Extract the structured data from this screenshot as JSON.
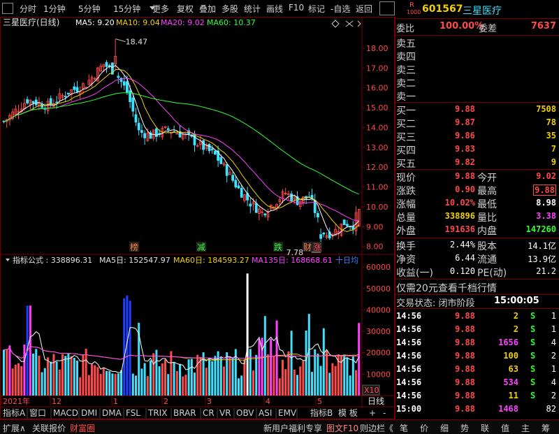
{
  "toolbar": {
    "left": [
      "分时",
      "1分钟",
      "5分钟",
      "15分钟",
      "更多"
    ],
    "right": [
      "复权",
      "叠加",
      "多股",
      "统计",
      "画线",
      "F10",
      "标记",
      "-自选",
      "返回"
    ]
  },
  "chart_header": {
    "name": "三星医疗(日线)",
    "ma": [
      {
        "label": "MA5: 9.20",
        "color": "#ffffff"
      },
      {
        "label": "MA10: 9.04",
        "color": "#f0d000"
      },
      {
        "label": "MA20: 9.02",
        "color": "#ff40ff"
      },
      {
        "label": "MA60: 10.37",
        "color": "#30ff30"
      }
    ],
    "high_marker": "18.47",
    "low_marker": "7.78"
  },
  "price_axis": [
    "18.00",
    "17.00",
    "16.00",
    "15.00",
    "14.00",
    "13.00",
    "12.00",
    "11.00",
    "10.00",
    "9.00",
    "8.00"
  ],
  "event_tags": [
    "榜",
    "减",
    "跌",
    "财",
    "涨"
  ],
  "vol_header": {
    "title": "指标公式 : 338896.31",
    "ma5": "MA5日: 152547.97",
    "ma60": "MA60日: 184593.27",
    "ma135": "MA135日: 168668.61",
    "tail": "十日均"
  },
  "vol_axis": [
    "60000",
    "50000",
    "40000",
    "30000",
    "20000",
    "10000"
  ],
  "vol_unit": "X10",
  "date_axis": [
    "2021年",
    "12",
    "1",
    "2",
    "3",
    "4",
    "5"
  ],
  "period_label": "日线",
  "indicator_tabs": [
    "指标A",
    "窗口",
    "MACD",
    "DMI",
    "DMA",
    "FSL",
    "TRIX",
    "BRAR",
    "CR",
    "VR",
    "OBV",
    "ASI",
    "EMV"
  ],
  "indicator_tabs_right": [
    "指标B",
    "模 板"
  ],
  "bottom_left": [
    "扩展∧",
    "关联报价",
    "财富圈"
  ],
  "bottom_mid": [
    "新用户福利专享",
    "图文F10",
    "则边栏《"
  ],
  "bottom_right": [
    "笔",
    "价",
    "细",
    "势",
    "联",
    "值",
    "主",
    "筹"
  ],
  "quote": {
    "badge_top": "R",
    "badge_bottom": "1000",
    "code": "601567",
    "name": "三星医疗",
    "weibi_label": "委比",
    "weibi": "100.00%",
    "weicha_label": "委差",
    "weicha": "7637",
    "sells": [
      "卖五",
      "卖四",
      "卖三",
      "卖二",
      "卖一"
    ],
    "buys": [
      {
        "label": "买一",
        "price": "9.88",
        "vol": "7508"
      },
      {
        "label": "买二",
        "price": "9.87",
        "vol": "78"
      },
      {
        "label": "买三",
        "price": "9.86",
        "vol": "35"
      },
      {
        "label": "买四",
        "price": "9.83",
        "vol": "7"
      },
      {
        "label": "买五",
        "price": "9.82",
        "vol": "9"
      }
    ],
    "stats": [
      {
        "l1": "现价",
        "v1": "9.88",
        "c1": "red",
        "l2": "今开",
        "v2": "9.02",
        "c2": "red"
      },
      {
        "l1": "涨跌",
        "v1": "0.90",
        "c1": "red",
        "l2": "最高",
        "v2": "9.88",
        "c2": "red"
      },
      {
        "l1": "涨幅",
        "v1": "10.02%",
        "c1": "red",
        "l2": "最低",
        "v2": "8.98",
        "c2": "white"
      },
      {
        "l1": "总量",
        "v1": "338896",
        "c1": "yellow",
        "l2": "量比",
        "v2": "3.38",
        "c2": "magenta"
      },
      {
        "l1": "外盘",
        "v1": "191636",
        "c1": "red",
        "l2": "内盘",
        "v2": "147260",
        "c2": "green"
      }
    ],
    "stats2": [
      {
        "l1": "换手",
        "v1": "2.44%",
        "l2": "股本",
        "v2": "14.1亿"
      },
      {
        "l1": "净资",
        "v1": "6.44",
        "l2": "流通",
        "v2": "13.9亿"
      },
      {
        "l1": "收益(一)",
        "v1": "0.120",
        "l2": "PE(动)",
        "v2": "21.2"
      }
    ],
    "promo": "仅需20元查看千档行情",
    "status_label": "交易状态: 闭市阶段",
    "status_time": "15:00:05",
    "ticks": [
      {
        "t": "14:56",
        "p": "9.88",
        "v": "2",
        "vc": "yellow",
        "s": "S",
        "n": "1"
      },
      {
        "t": "14:56",
        "p": "9.88",
        "v": "2",
        "vc": "yellow",
        "s": "S",
        "n": "1"
      },
      {
        "t": "14:56",
        "p": "9.88",
        "v": "1656",
        "vc": "magenta",
        "s": "S",
        "n": "4"
      },
      {
        "t": "14:56",
        "p": "9.88",
        "v": "100",
        "vc": "yellow",
        "s": "S",
        "n": "2"
      },
      {
        "t": "14:56",
        "p": "9.88",
        "v": "63",
        "vc": "yellow",
        "s": "S",
        "n": "1"
      },
      {
        "t": "14:56",
        "p": "9.88",
        "v": "534",
        "vc": "magenta",
        "s": "S",
        "n": "4"
      },
      {
        "t": "14:56",
        "p": "9.88",
        "v": "11",
        "vc": "yellow",
        "s": "S",
        "n": "2"
      },
      {
        "t": "15:00",
        "p": "9.88",
        "v": "1468",
        "vc": "magenta",
        "s": "",
        "n": "82"
      }
    ]
  },
  "colors": {
    "up": "#ff4a4a",
    "down": "#40e0ff",
    "border": "#7a0000"
  }
}
